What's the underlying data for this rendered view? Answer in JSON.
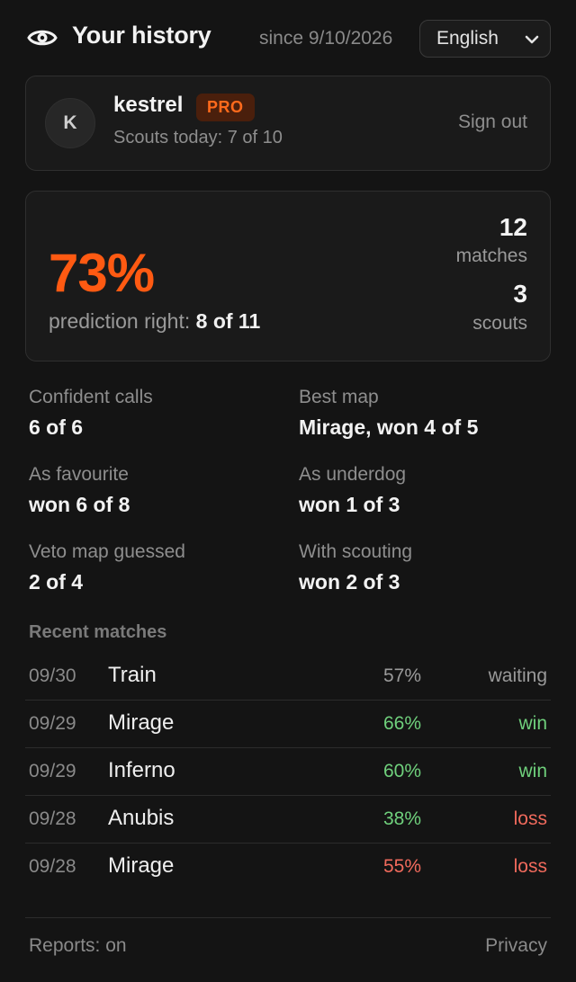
{
  "header": {
    "title": "Your history",
    "since": "since 9/10/2026",
    "language": "English"
  },
  "account": {
    "avatar_letter": "K",
    "username": "kestrel",
    "badge": "PRO",
    "scouts_today": "Scouts today: 7 of 10",
    "sign_out": "Sign out"
  },
  "summary": {
    "accuracy": "73%",
    "prediction_label": "prediction right: ",
    "prediction_value": "8 of 11",
    "matches_count": "12",
    "matches_label": "matches",
    "scouts_count": "3",
    "scouts_label": "scouts"
  },
  "grid": [
    {
      "label": "Confident calls",
      "value": "6 of 6"
    },
    {
      "label": "Best map",
      "value": "Mirage, won 4 of 5"
    },
    {
      "label": "As favourite",
      "value": "won 6 of 8"
    },
    {
      "label": "As underdog",
      "value": "won 1 of 3"
    },
    {
      "label": "Veto map guessed",
      "value": "2 of 4"
    },
    {
      "label": "With scouting",
      "value": "won 2 of 3"
    }
  ],
  "recent": {
    "title": "Recent matches",
    "rows": [
      {
        "date": "09/30",
        "map": "Train",
        "pct": "57%",
        "result": "waiting",
        "pct_color": "#9a9a9a",
        "res_color": "#9a9a9a"
      },
      {
        "date": "09/29",
        "map": "Mirage",
        "pct": "66%",
        "result": "win",
        "pct_color": "#6fd07c",
        "res_color": "#6fd07c"
      },
      {
        "date": "09/29",
        "map": "Inferno",
        "pct": "60%",
        "result": "win",
        "pct_color": "#6fd07c",
        "res_color": "#6fd07c"
      },
      {
        "date": "09/28",
        "map": "Anubis",
        "pct": "38%",
        "result": "loss",
        "pct_color": "#6fd07c",
        "res_color": "#f06a5c"
      },
      {
        "date": "09/28",
        "map": "Mirage",
        "pct": "55%",
        "result": "loss",
        "pct_color": "#f06a5c",
        "res_color": "#f06a5c"
      }
    ]
  },
  "footer": {
    "reports": "Reports: on",
    "privacy": "Privacy"
  },
  "colors": {
    "accent": "#ff5a12",
    "win": "#6fd07c",
    "loss": "#f06a5c"
  },
  "icons": {
    "header": "eye-icon",
    "language": "chevron-down-icon"
  }
}
